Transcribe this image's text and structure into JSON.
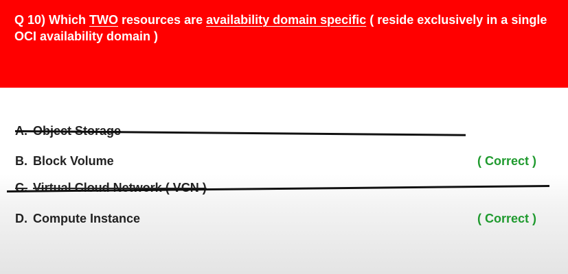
{
  "question": {
    "prefix": "Q 10)  Which ",
    "emphasis_two": "TWO",
    "middle": " resources are ",
    "emphasis_topic": "availability domain specific",
    "suffix": " ( reside exclusively in a single OCI availability domain )"
  },
  "options": [
    {
      "letter": "A.",
      "text": "Object Storage",
      "struck_out": true,
      "status": ""
    },
    {
      "letter": "B.",
      "text": "Block Volume",
      "struck_out": false,
      "status": "( Correct )"
    },
    {
      "letter": "C.",
      "text": "Virtual Cloud Network ( VCN )",
      "struck_out": true,
      "status": ""
    },
    {
      "letter": "D.",
      "text": "Compute Instance",
      "struck_out": false,
      "status": "( Correct )"
    }
  ],
  "colors": {
    "banner": "#ff0000",
    "question_text": "#ffffff",
    "correct_text": "#1f9a2e",
    "option_text": "#222222"
  }
}
